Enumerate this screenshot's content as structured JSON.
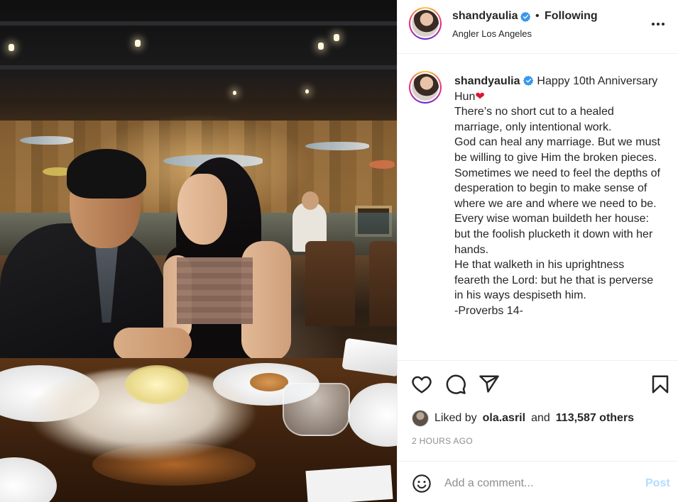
{
  "post": {
    "photo_alt": "",
    "censor_color": "#8e6d5e"
  },
  "header": {
    "username": "shandyaulia",
    "separator": "•",
    "follow_status": "Following",
    "location": "Angler Los Angeles",
    "verified_icon": "verified-badge-icon",
    "more_icon": "more-options-icon"
  },
  "caption": {
    "username": "shandyaulia",
    "lines": [
      "Happy 10th Anniversary",
      "Hun",
      "",
      "There’s no short cut to a healed",
      "marriage, only intentional work.",
      "God can heal any marriage. But we must",
      "be willing to give Him the broken pieces.",
      "Sometimes we need to feel the depths of",
      "desperation to begin to make sense of",
      "where we are and where we need to be.",
      "",
      "Every wise woman buildeth her house:",
      "but the foolish plucketh it down with her",
      "hands.",
      "He that walketh in his uprightness",
      "feareth the Lord: but he that is perverse",
      "in his ways despiseth him.",
      "-Proverbs 14-"
    ],
    "emoji": "❤"
  },
  "actions": {
    "icons": [
      "heart-icon",
      "comment-icon",
      "share-icon",
      "bookmark-icon"
    ],
    "liked_by_prefix": "Liked by",
    "liked_by_user": "ola.asril",
    "liked_by_and": "and",
    "liked_by_count": "113,587 others",
    "timestamp": "2 HOURS AGO"
  },
  "comment": {
    "placeholder": "Add a comment...",
    "post_label": "Post",
    "emoji_icon": "smiley-icon"
  },
  "colors": {
    "text": "#262626",
    "muted": "#8e8e8e",
    "post_disabled": "#b3dbff",
    "verified": "#3897f0",
    "heart": "#e0122e"
  }
}
